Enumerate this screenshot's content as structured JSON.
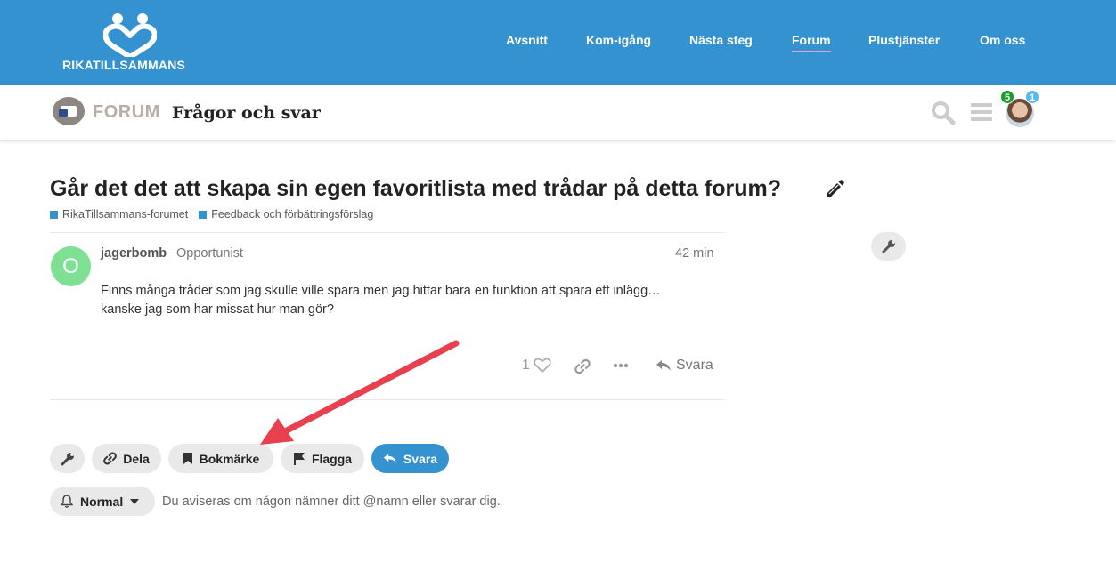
{
  "brand": {
    "name": "RIKATILLSAMMANS"
  },
  "topnav": [
    {
      "label": "Avsnitt"
    },
    {
      "label": "Kom-igång"
    },
    {
      "label": "Nästa steg"
    },
    {
      "label": "Forum",
      "active": true
    },
    {
      "label": "Plustjänster"
    },
    {
      "label": "Om oss"
    }
  ],
  "header": {
    "forum_label": "FORUM",
    "forum_title": "Frågor och svar",
    "badges": {
      "notifications": "5",
      "messages": "1"
    }
  },
  "topic": {
    "title": "Går det det att skapa sin egen favoritlista med trådar på detta forum?",
    "categories": [
      "RikaTillsammans-forumet",
      "Feedback och förbättringsförslag"
    ]
  },
  "post": {
    "avatar_letter": "O",
    "username": "jagerbomb",
    "user_title": "Opportunist",
    "time": "42 min",
    "body_line1": "Finns många tråder som jag skulle ville spara men jag hittar bara en funktion att spara ett inlägg…",
    "body_line2": "kanske jag som har missat hur man gör?",
    "likes": "1",
    "reply_label": "Svara"
  },
  "footer_buttons": {
    "share": "Dela",
    "bookmark": "Bokmärke",
    "flag": "Flagga",
    "reply": "Svara"
  },
  "notifications": {
    "level": "Normal",
    "description": "Du aviseras om någon nämner ditt @namn eller svarar dig."
  },
  "colors": {
    "brand_blue": "#3392cf",
    "annotation_arrow": "#e8404f",
    "avatar_green": "#7ee093"
  }
}
